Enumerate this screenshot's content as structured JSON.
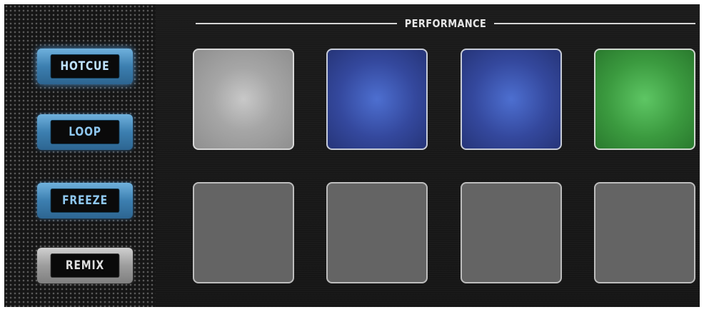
{
  "section": {
    "title": "PERFORMANCE"
  },
  "mode_buttons": [
    {
      "label": "HOTCUE",
      "state": "active",
      "color": "#5aa7e0"
    },
    {
      "label": "LOOP",
      "state": "inactive",
      "color": "#5aa7e0"
    },
    {
      "label": "FREEZE",
      "state": "inactive",
      "color": "#5aa7e0"
    },
    {
      "label": "REMIX",
      "state": "inactive",
      "color": "#b5b5b5"
    }
  ],
  "pads": [
    {
      "row": 1,
      "col": 1,
      "state": "lit",
      "color": "#a6a6a6"
    },
    {
      "row": 1,
      "col": 2,
      "state": "lit",
      "color": "#3a4fa8"
    },
    {
      "row": 1,
      "col": 3,
      "state": "lit",
      "color": "#3a4fa8"
    },
    {
      "row": 1,
      "col": 4,
      "state": "lit",
      "color": "#3fa043"
    },
    {
      "row": 2,
      "col": 1,
      "state": "off",
      "color": "#646464"
    },
    {
      "row": 2,
      "col": 2,
      "state": "off",
      "color": "#646464"
    },
    {
      "row": 2,
      "col": 3,
      "state": "off",
      "color": "#646464"
    },
    {
      "row": 2,
      "col": 4,
      "state": "off",
      "color": "#646464"
    }
  ]
}
